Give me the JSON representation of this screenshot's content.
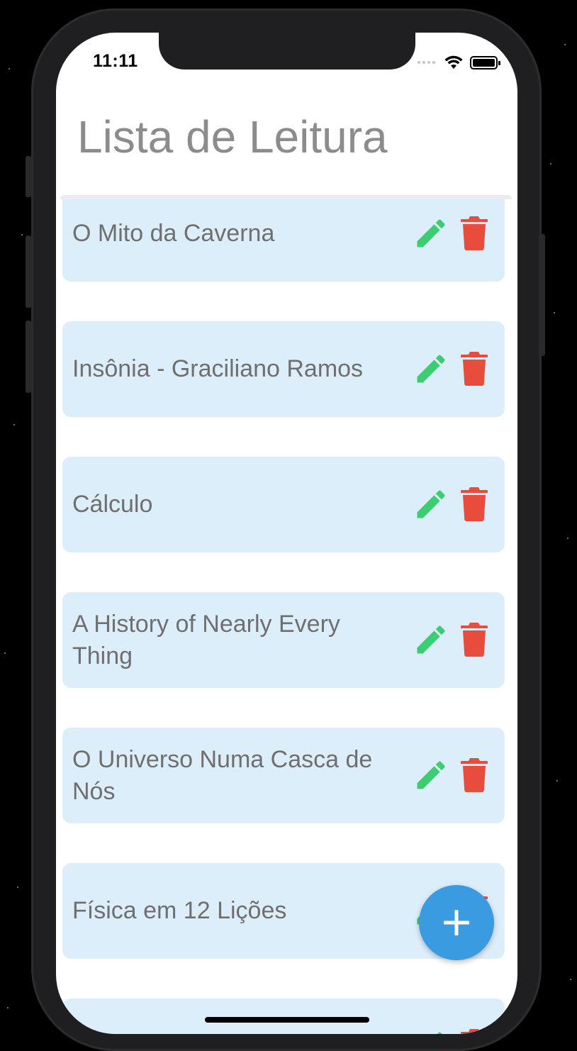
{
  "status_bar": {
    "time": "11:11"
  },
  "header": {
    "title": "Lista de Leitura"
  },
  "books": [
    {
      "title": "O Mito da Caverna"
    },
    {
      "title": "Insônia - Graciliano Ramos"
    },
    {
      "title": "Cálculo"
    },
    {
      "title": "A History of Nearly Every Thing"
    },
    {
      "title": "O Universo Numa Casca de Nós"
    },
    {
      "title": "Física em 12 Lições"
    },
    {
      "title": ""
    }
  ],
  "icons": {
    "edit": "pencil-icon",
    "delete": "trash-icon",
    "add": "plus-icon"
  },
  "colors": {
    "card_bg": "#ddeefb",
    "edit": "#3ccc72",
    "delete": "#e84c3d",
    "fab": "#3b9be0",
    "title": "#8c8c8c",
    "item_text": "#6f6f6f"
  }
}
